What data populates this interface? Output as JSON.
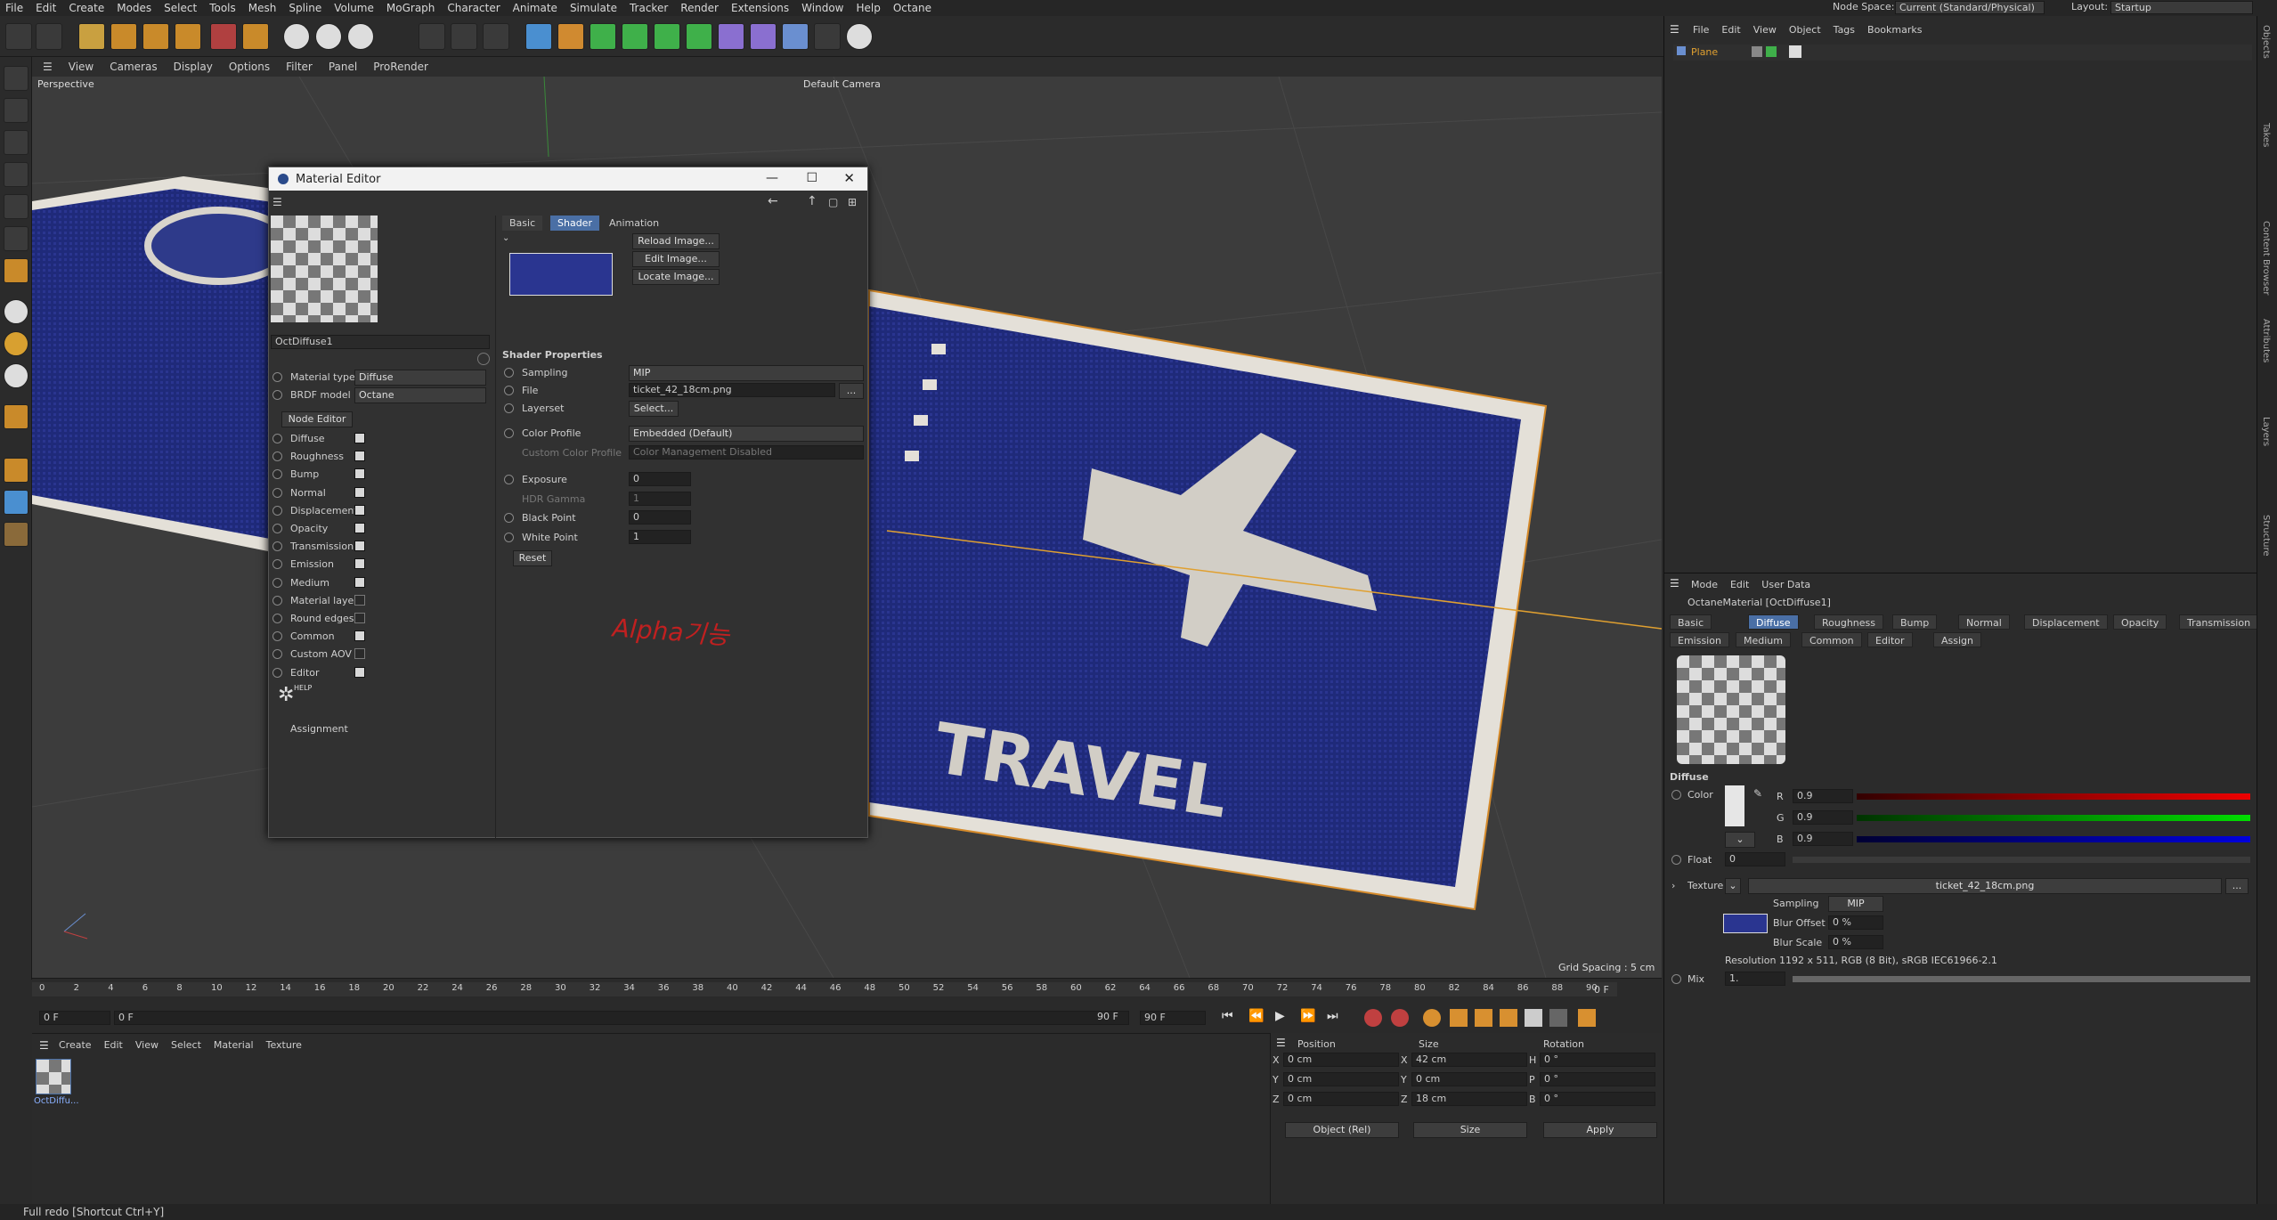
{
  "menu": [
    "File",
    "Edit",
    "Create",
    "Modes",
    "Select",
    "Tools",
    "Mesh",
    "Spline",
    "Volume",
    "MoGraph",
    "Character",
    "Animate",
    "Simulate",
    "Tracker",
    "Render",
    "Extensions",
    "Window",
    "Help",
    "Octane"
  ],
  "node_space": {
    "label": "Node Space:",
    "value": "Current (Standard/Physical)"
  },
  "layout": {
    "label": "Layout:",
    "value": "Startup"
  },
  "viewport_menu": [
    "View",
    "Cameras",
    "Display",
    "Options",
    "Filter",
    "Panel",
    "ProRender"
  ],
  "viewport": {
    "name": "Perspective",
    "camera": "Default Camera",
    "grid": "Grid Spacing : 5 cm",
    "travel_text": "TRAVEL"
  },
  "timeline": {
    "ticks": [
      "0",
      "2",
      "4",
      "6",
      "8",
      "10",
      "12",
      "14",
      "16",
      "18",
      "20",
      "22",
      "24",
      "26",
      "28",
      "30",
      "32",
      "34",
      "36",
      "38",
      "40",
      "42",
      "44",
      "46",
      "48",
      "50",
      "52",
      "54",
      "56",
      "58",
      "60",
      "62",
      "64",
      "66",
      "68",
      "70",
      "72",
      "74",
      "76",
      "78",
      "80",
      "82",
      "84",
      "86",
      "88",
      "90"
    ],
    "end_frame": "0 F",
    "start": "0 F",
    "current": "0 F",
    "range_end": "90 F",
    "range_end2": "90 F"
  },
  "material_menu": [
    "Create",
    "Edit",
    "View",
    "Select",
    "Material",
    "Texture"
  ],
  "material_thumb": "OctDiffu...",
  "coords": {
    "headers": [
      "Position",
      "Size",
      "Rotation"
    ],
    "rows": [
      {
        "axis": "X",
        "pos": "0 cm",
        "saxis": "X",
        "size": "42 cm",
        "raxis": "H",
        "rot": "0 °"
      },
      {
        "axis": "Y",
        "pos": "0 cm",
        "saxis": "Y",
        "size": "0 cm",
        "raxis": "P",
        "rot": "0 °"
      },
      {
        "axis": "Z",
        "pos": "0 cm",
        "saxis": "Z",
        "size": "18 cm",
        "raxis": "B",
        "rot": "0 °"
      }
    ],
    "mode": "Object (Rel)",
    "size_mode": "Size",
    "apply": "Apply"
  },
  "status": "Full redo [Shortcut Ctrl+Y]",
  "objects": {
    "menu": [
      "File",
      "Edit",
      "View",
      "Object",
      "Tags",
      "Bookmarks"
    ],
    "item": "Plane"
  },
  "attributes": {
    "menu": [
      "Mode",
      "Edit",
      "User Data"
    ],
    "title": "OctaneMaterial [OctDiffuse1]",
    "tabs1": [
      "Basic",
      "Diffuse",
      "Roughness",
      "Bump",
      "Normal",
      "Displacement",
      "Opacity",
      "Transmission"
    ],
    "tabs2": [
      "Emission",
      "Medium",
      "Common",
      "Editor",
      "Assign"
    ],
    "active_tab": "Diffuse",
    "section": "Diffuse",
    "color_label": "Color",
    "r": "0.9",
    "g": "0.9",
    "b": "0.9",
    "float_label": "Float",
    "float": "0",
    "texture_label": "Texture",
    "texture": "ticket_42_18cm.png",
    "sampling_label": "Sampling",
    "sampling": "MIP",
    "blur_offset_label": "Blur Offset",
    "blur_offset": "0 %",
    "blur_scale_label": "Blur Scale",
    "blur_scale": "0 %",
    "resolution": "Resolution 1192 x 511, RGB (8 Bit), sRGB IEC61966-2.1",
    "mix_label": "Mix",
    "mix": "1."
  },
  "side_tabs": [
    "Objects",
    "Takes",
    "Content Browser",
    "Attributes",
    "Layers",
    "Structure"
  ],
  "dialog": {
    "title": "Material Editor",
    "mat_name": "OctDiffuse1",
    "material_type_label": "Material type",
    "material_type": "Diffuse",
    "brdf_label": "BRDF model",
    "brdf": "Octane",
    "node_editor": "Node Editor",
    "channels": [
      {
        "name": "Diffuse",
        "on": true
      },
      {
        "name": "Roughness",
        "on": true
      },
      {
        "name": "Bump",
        "on": true
      },
      {
        "name": "Normal",
        "on": true
      },
      {
        "name": "Displacement",
        "on": true
      },
      {
        "name": "Opacity",
        "on": true
      },
      {
        "name": "Transmission",
        "on": true
      },
      {
        "name": "Emission",
        "on": true
      },
      {
        "name": "Medium",
        "on": true
      },
      {
        "name": "Material layer",
        "on": false
      },
      {
        "name": "Round edges",
        "on": false
      },
      {
        "name": "Common",
        "on": true
      },
      {
        "name": "Custom AOV",
        "on": false
      },
      {
        "name": "Editor",
        "on": true
      }
    ],
    "help": "HELP",
    "assignment": "Assignment",
    "tabs": [
      "Basic",
      "Shader",
      "Animation"
    ],
    "active_tab": "Shader",
    "reload": "Reload Image...",
    "edit": "Edit Image...",
    "locate": "Locate Image...",
    "shader_props": "Shader Properties",
    "sampling_label": "Sampling",
    "sampling": "MIP",
    "file_label": "File",
    "file": "ticket_42_18cm.png",
    "layerset_label": "Layerset",
    "layerset_btn": "Select...",
    "color_profile_label": "Color Profile",
    "color_profile": "Embedded (Default)",
    "custom_profile_label": "Custom Color Profile",
    "custom_profile": "Color Management Disabled",
    "exposure_label": "Exposure",
    "exposure": "0",
    "hdr_label": "HDR Gamma",
    "hdr": "1",
    "black_label": "Black Point",
    "black": "0",
    "white_label": "White Point",
    "white": "1",
    "reset": "Reset",
    "handwriting": "Alpha기능"
  }
}
